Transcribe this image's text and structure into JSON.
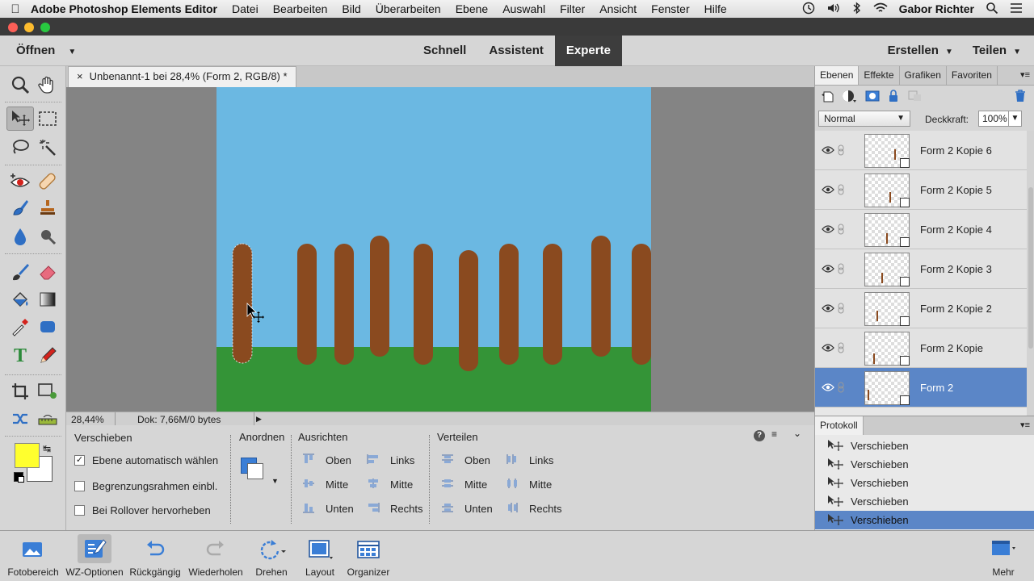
{
  "menubar": {
    "app_name": "Adobe Photoshop Elements Editor",
    "items": [
      "Datei",
      "Bearbeiten",
      "Bild",
      "Überarbeiten",
      "Ebene",
      "Auswahl",
      "Filter",
      "Ansicht",
      "Fenster",
      "Hilfe"
    ],
    "user": "Gabor Richter"
  },
  "topbar": {
    "open_label": "Öffnen",
    "modes": [
      "Schnell",
      "Assistent",
      "Experte"
    ],
    "active_mode": "Experte",
    "create_label": "Erstellen",
    "share_label": "Teilen"
  },
  "document": {
    "tab_title": "Unbenannt-1 bei 28,4% (Form 2, RGB/8) *",
    "close_symbol": "×",
    "zoom": "28,44%",
    "doc_info": "Dok: 7,66M/0 bytes"
  },
  "canvas": {
    "sky_color": "#6bb8e2",
    "grass_color": "#349437",
    "post_color": "#8a4a1f"
  },
  "tool_options": {
    "tool_name": "Verschieben",
    "checkboxes": [
      {
        "label": "Ebene automatisch wählen",
        "checked": true
      },
      {
        "label": "Begrenzungsrahmen einbl.",
        "checked": false
      },
      {
        "label": "Bei Rollover hervorheben",
        "checked": false
      }
    ],
    "arrange_title": "Anordnen",
    "align_title": "Ausrichten",
    "align_col1": [
      "Oben",
      "Mitte",
      "Unten"
    ],
    "align_col2": [
      "Links",
      "Mitte",
      "Rechts"
    ],
    "distribute_title": "Verteilen",
    "distribute_col1": [
      "Oben",
      "Mitte",
      "Unten"
    ],
    "distribute_col2": [
      "Links",
      "Mitte",
      "Rechts"
    ]
  },
  "panel": {
    "tabs": [
      "Ebenen",
      "Effekte",
      "Grafiken",
      "Favoriten"
    ],
    "active_tab": "Ebenen",
    "blend_mode": "Normal",
    "opacity_label": "Deckkraft:",
    "opacity_value": "100%",
    "layers": [
      {
        "name": "Form 2 Kopie 6",
        "selected": false
      },
      {
        "name": "Form 2 Kopie 5",
        "selected": false
      },
      {
        "name": "Form 2 Kopie 4",
        "selected": false
      },
      {
        "name": "Form 2 Kopie 3",
        "selected": false
      },
      {
        "name": "Form 2 Kopie 2",
        "selected": false
      },
      {
        "name": "Form 2 Kopie",
        "selected": false
      },
      {
        "name": "Form 2",
        "selected": true
      }
    ]
  },
  "history": {
    "title": "Protokoll",
    "items": [
      "Verschieben",
      "Verschieben",
      "Verschieben",
      "Verschieben",
      "Verschieben"
    ]
  },
  "bottombar": {
    "items": [
      "Fotobereich",
      "WZ-Optionen",
      "Rückgängig",
      "Wiederholen",
      "Drehen",
      "Layout",
      "Organizer"
    ],
    "more": "Mehr"
  }
}
